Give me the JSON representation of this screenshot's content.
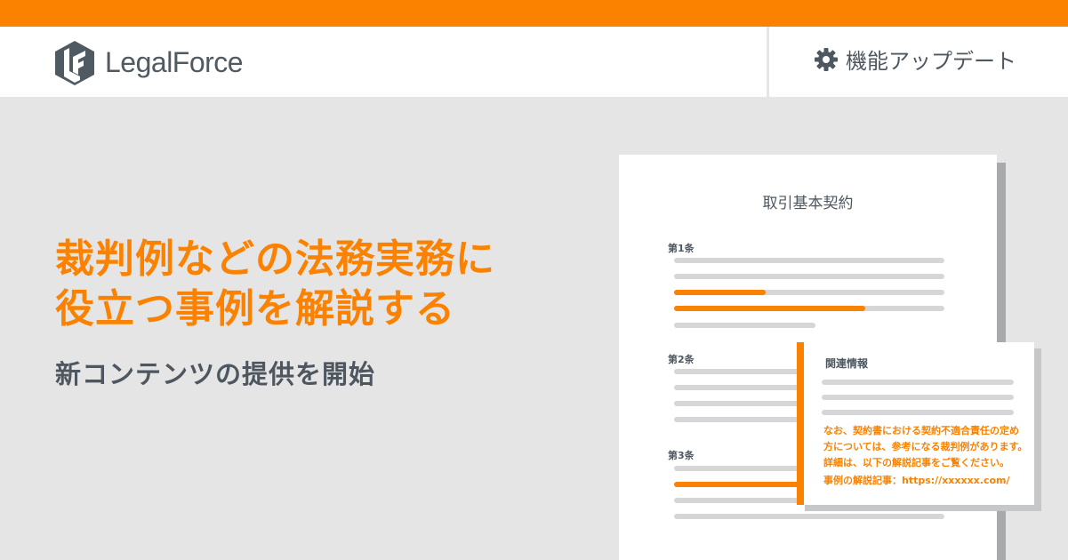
{
  "header": {
    "brand": "LegalForce",
    "update_label": "機能アップデート",
    "icons": {
      "logo": "legalforce-logo-icon",
      "update": "gear-icon"
    }
  },
  "headline": {
    "line1": "裁判例などの法務実務に",
    "line2": "役立つ事例を解説する",
    "sub": "新コンテンツの提供を開始"
  },
  "document": {
    "title": "取引基本契約",
    "articles": [
      "第1条",
      "第2条",
      "第3条"
    ]
  },
  "panel": {
    "title": "関連情報",
    "lines": [
      "なお、契約書における契約不適合責任の定め",
      "方については、参考になる裁判例があります。",
      "詳細は、以下の解説記事をご覧ください。",
      "事例の解説記事：https://xxxxxx.com/"
    ]
  },
  "colors": {
    "accent": "#fb8200",
    "text": "#4e5760",
    "background": "#e5e5e5"
  }
}
